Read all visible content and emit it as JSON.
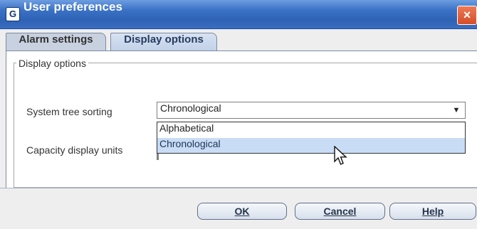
{
  "window": {
    "title": "User preferences",
    "app_icon_text": "G",
    "close_symbol": "×"
  },
  "tabs": [
    {
      "label": "Alarm settings",
      "active": false
    },
    {
      "label": "Display options",
      "active": true
    }
  ],
  "group": {
    "label": "Display options"
  },
  "fields": {
    "sorting_label": "System tree sorting",
    "sorting_value": "Chronological",
    "capacity_label": "Capacity display units"
  },
  "dropdown": {
    "options": [
      "Alphabetical",
      "Chronological"
    ],
    "selected_index": 1
  },
  "buttons": {
    "ok": "OK",
    "cancel": "Cancel",
    "help": "Help"
  },
  "colors": {
    "title_bar": "#3b72c6",
    "selected_option": "#c8dcf5"
  }
}
